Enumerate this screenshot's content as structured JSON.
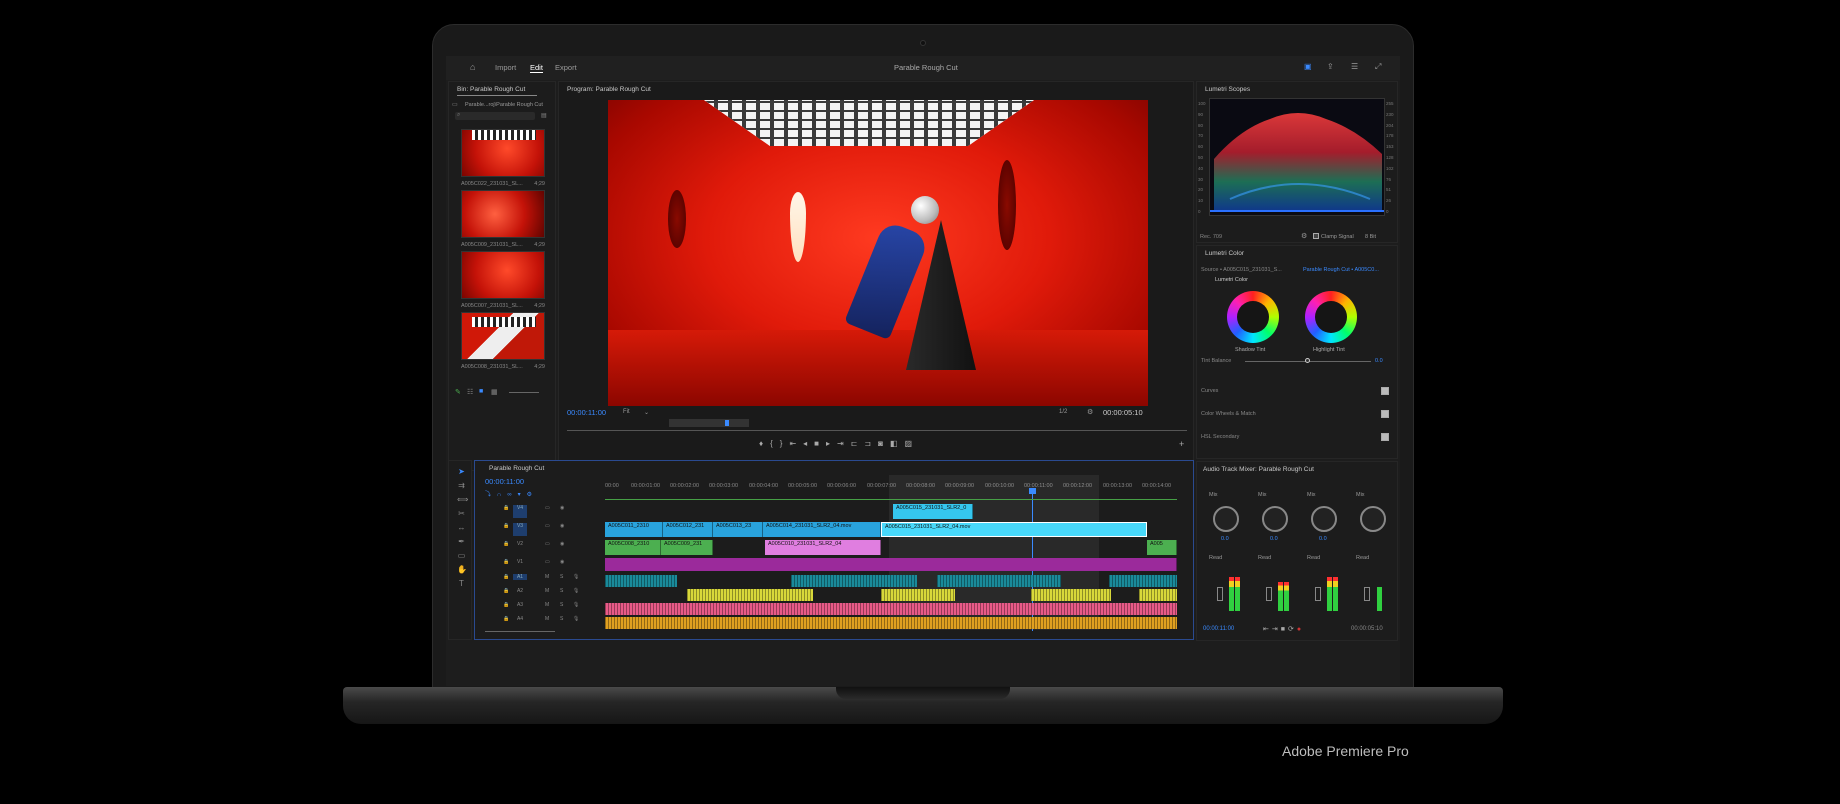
{
  "app": {
    "title": "Parable Rough Cut",
    "caption": "Adobe Premiere Pro",
    "tabs": [
      "Import",
      "Edit",
      "Export"
    ],
    "active_tab": "Edit"
  },
  "bin": {
    "title": "Bin: Parable Rough Cut",
    "path": "Parable...roj\\Parable Rough Cut",
    "items": [
      {
        "name": "A005C022_231031_SL...",
        "duration": "4;29"
      },
      {
        "name": "A005C009_231031_SL...",
        "duration": "4;29"
      },
      {
        "name": "A005C007_231031_SL...",
        "duration": "4;29"
      },
      {
        "name": "A005C008_231031_SL...",
        "duration": "4;29"
      }
    ]
  },
  "program": {
    "title": "Program: Parable Rough Cut",
    "timecode": "00:00:11:00",
    "fit": "Fit",
    "resolution": "1/2",
    "duration": "00:00:05:10"
  },
  "scopes": {
    "title": "Lumetri Scopes",
    "left_scale": [
      "100",
      "90",
      "80",
      "70",
      "60",
      "50",
      "40",
      "30",
      "20",
      "10",
      "0"
    ],
    "right_scale": [
      "255",
      "230",
      "204",
      "178",
      "153",
      "128",
      "102",
      "76",
      "51",
      "26",
      "0"
    ],
    "rec": "Rec. 709",
    "clamp": "Clamp Signal",
    "bits": "8 Bit"
  },
  "lumetri": {
    "title": "Lumetri Color",
    "source": "Source • A005C015_231031_S...",
    "target": "Parable Rough Cut • A005C0...",
    "effect": "Lumetri Color",
    "shadow": "Shadow Tint",
    "highlight": "Highlight Tint",
    "tint_balance": "Tint Balance",
    "tint_value": "0.0",
    "sections": [
      "Curves",
      "Color Wheels & Match",
      "HSL Secondary"
    ]
  },
  "timeline": {
    "title": "Parable Rough Cut",
    "timecode": "00:00:11:00",
    "ruler": [
      "00:00",
      "00:00:01:00",
      "00:00:02:00",
      "00:00:03:00",
      "00:00:04:00",
      "00:00:05:00",
      "00:00:06:00",
      "00:00:07:00",
      "00:00:08:00",
      "00:00:09:00",
      "00:00:10:00",
      "00:00:11:00",
      "00:00:12:00",
      "00:00:13:00",
      "00:00:14:00"
    ],
    "video_tracks": [
      "V4",
      "V3",
      "V2",
      "V1"
    ],
    "audio_tracks": [
      "A1",
      "A2",
      "A3",
      "A4"
    ],
    "clips": {
      "v4": "A005C015_231031_SLR2_0",
      "v3a": "A005C011_2310",
      "v3b": "A005C012_231",
      "v3c": "A005C013_23",
      "v3d": "A005C014_231031_SLR2_04.mov",
      "v3e": "A005C015_231031_SLR2_04.mov",
      "v2a": "A005C008_2310",
      "v2b": "A005C009_231",
      "v2c": "A005C010_231031_SLR2_04",
      "v2d": "A005"
    }
  },
  "mixer": {
    "title": "Audio Track Mixer: Parable Rough Cut",
    "mix_label": "Mix",
    "read_label": "Read",
    "knob_value": "0.0",
    "timecode": "00:00:11:00",
    "duration": "00:00:05:10"
  }
}
